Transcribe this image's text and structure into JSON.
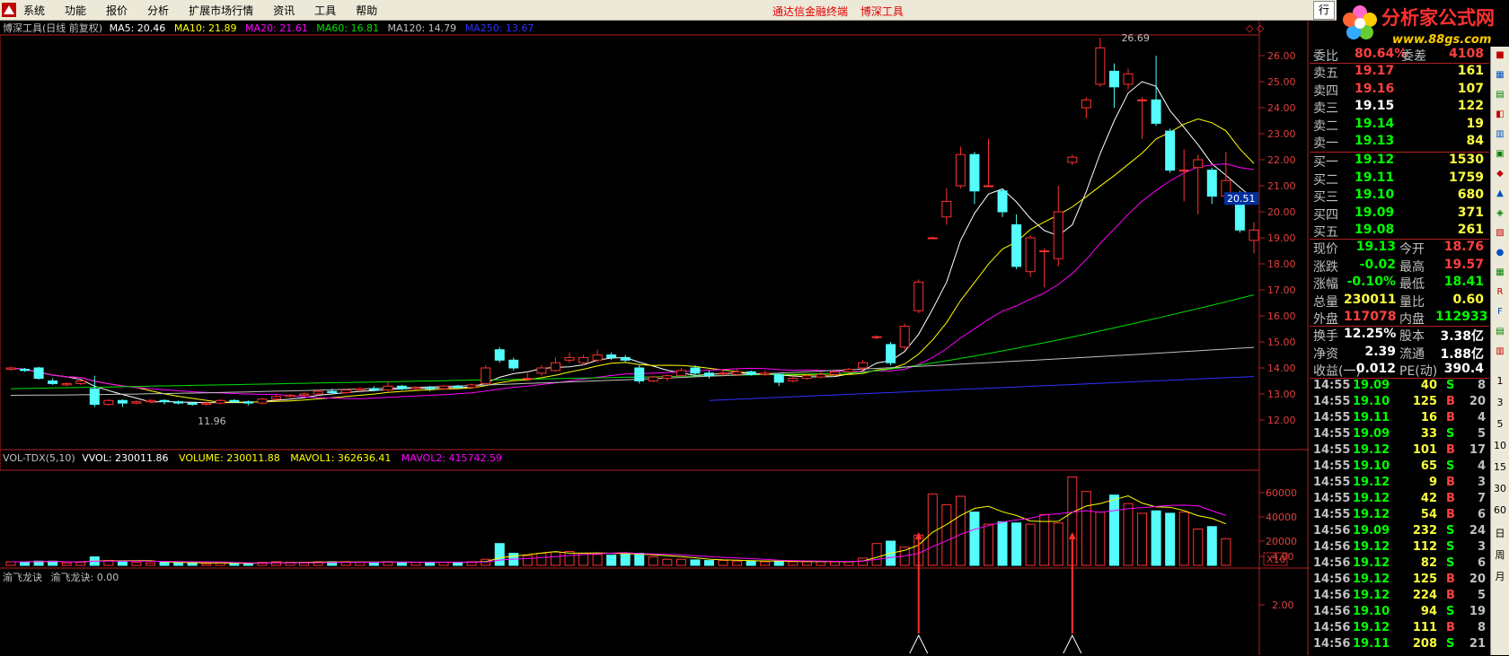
{
  "menu": {
    "items": [
      "系统",
      "功能",
      "报价",
      "分析",
      "扩展市场行情",
      "资讯",
      "工具",
      "帮助"
    ],
    "center": [
      "通达信金融终端",
      "博深工具"
    ],
    "right_box": "行"
  },
  "brand": {
    "title": "分析家公式网",
    "url": "www.88gs.com"
  },
  "main_chart": {
    "header": {
      "name": "博深工具(日线 前复权)",
      "ma5": "MA5: 20.46",
      "ma10": "MA10: 21.89",
      "ma20": "MA20: 21.61",
      "ma60": "MA60: 16.81",
      "ma120": "MA120: 14.79",
      "ma250": "MA250: 13.67"
    },
    "high_label": "26.69",
    "low_label": "11.96",
    "cursor_price": "20.51",
    "y_ticks": [
      "26.00",
      "25.00",
      "24.00",
      "23.00",
      "22.00",
      "21.00",
      "20.00",
      "19.00",
      "18.00",
      "17.00",
      "16.00",
      "15.00",
      "14.00",
      "13.00",
      "12.00"
    ],
    "colors": {
      "up": "#ff3232",
      "down": "#54fcfc",
      "ma5": "#ffffff",
      "ma10": "#ffff00",
      "ma20": "#ff00ff",
      "ma60": "#00e000",
      "ma120": "#c0c0c0",
      "ma250": "#3030ff"
    }
  },
  "volume_chart": {
    "header": {
      "name": "VOL-TDX(5,10)",
      "vvol": "VVOL: 230011.86",
      "volume": "VOLUME: 230011.88",
      "mavol1": "MAVOL1: 362636.41",
      "mavol2": "MAVOL2: 415742.59"
    },
    "y_ticks": [
      "60000",
      "40000",
      "20000"
    ],
    "unit": "X10"
  },
  "indicator_chart": {
    "header": {
      "name": "渝飞龙诀",
      "value": "渝飞龙诀: 0.00"
    },
    "y_ticks": [
      "4.00",
      "2.00"
    ]
  },
  "quote": {
    "ratio": {
      "label": "委比",
      "value": "80.64%",
      "label2": "委差",
      "value2": "4108"
    },
    "sells": [
      {
        "label": "卖五",
        "price": "19.17",
        "vol": "161"
      },
      {
        "label": "卖四",
        "price": "19.16",
        "vol": "107"
      },
      {
        "label": "卖三",
        "price": "19.15",
        "vol": "122"
      },
      {
        "label": "卖二",
        "price": "19.14",
        "vol": "19"
      },
      {
        "label": "卖一",
        "price": "19.13",
        "vol": "84"
      }
    ],
    "buys": [
      {
        "label": "买一",
        "price": "19.12",
        "vol": "1530"
      },
      {
        "label": "买二",
        "price": "19.11",
        "vol": "1759"
      },
      {
        "label": "买三",
        "price": "19.10",
        "vol": "680"
      },
      {
        "label": "买四",
        "price": "19.09",
        "vol": "371"
      },
      {
        "label": "买五",
        "price": "19.08",
        "vol": "261"
      }
    ],
    "stats": [
      {
        "l1": "现价",
        "v1": "19.13",
        "l2": "今开",
        "v2": "18.76"
      },
      {
        "l1": "涨跌",
        "v1": "-0.02",
        "l2": "最高",
        "v2": "19.57"
      },
      {
        "l1": "涨幅",
        "v1": "-0.10%",
        "l2": "最低",
        "v2": "18.41"
      },
      {
        "l1": "总量",
        "v1": "230011",
        "l2": "量比",
        "v2": "0.60"
      },
      {
        "l1": "外盘",
        "v1": "117078",
        "l2": "内盘",
        "v2": "112933"
      }
    ],
    "fundamentals": [
      {
        "l1": "换手",
        "v1": "12.25%",
        "l2": "股本",
        "v2": "3.38亿"
      },
      {
        "l1": "净资",
        "v1": "2.39",
        "l2": "流通",
        "v2": "1.88亿"
      },
      {
        "l1": "收益(一)",
        "v1": "0.012",
        "l2": "PE(动)",
        "v2": "390.4"
      }
    ],
    "ticks": [
      {
        "time": "14:55",
        "price": "19.09",
        "vol": "40",
        "bs": "S",
        "n": "8"
      },
      {
        "time": "14:55",
        "price": "19.10",
        "vol": "125",
        "bs": "B",
        "n": "20"
      },
      {
        "time": "14:55",
        "price": "19.11",
        "vol": "16",
        "bs": "B",
        "n": "4"
      },
      {
        "time": "14:55",
        "price": "19.09",
        "vol": "33",
        "bs": "S",
        "n": "5"
      },
      {
        "time": "14:55",
        "price": "19.12",
        "vol": "101",
        "bs": "B",
        "n": "17"
      },
      {
        "time": "14:55",
        "price": "19.10",
        "vol": "65",
        "bs": "S",
        "n": "4"
      },
      {
        "time": "14:55",
        "price": "19.12",
        "vol": "9",
        "bs": "B",
        "n": "3"
      },
      {
        "time": "14:55",
        "price": "19.12",
        "vol": "42",
        "bs": "B",
        "n": "7"
      },
      {
        "time": "14:55",
        "price": "19.12",
        "vol": "54",
        "bs": "B",
        "n": "6"
      },
      {
        "time": "14:56",
        "price": "19.09",
        "vol": "232",
        "bs": "S",
        "n": "24"
      },
      {
        "time": "14:56",
        "price": "19.12",
        "vol": "112",
        "bs": "S",
        "n": "3"
      },
      {
        "time": "14:56",
        "price": "19.12",
        "vol": "82",
        "bs": "S",
        "n": "6"
      },
      {
        "time": "14:56",
        "price": "19.12",
        "vol": "125",
        "bs": "B",
        "n": "20"
      },
      {
        "time": "14:56",
        "price": "19.12",
        "vol": "224",
        "bs": "B",
        "n": "5"
      },
      {
        "time": "14:56",
        "price": "19.10",
        "vol": "94",
        "bs": "S",
        "n": "19"
      },
      {
        "time": "14:56",
        "price": "19.12",
        "vol": "111",
        "bs": "B",
        "n": "8"
      },
      {
        "time": "14:56",
        "price": "19.11",
        "vol": "208",
        "bs": "S",
        "n": "21"
      }
    ],
    "colors": {
      "up": "#ff4040",
      "down": "#00ff00",
      "label": "#c0c0c0",
      "neutral": "#ffffff",
      "yellow": "#ffff40"
    }
  },
  "toolbar": [
    "1",
    "3",
    "5",
    "10",
    "15",
    "30",
    "60",
    "日",
    "周",
    "月"
  ],
  "chart_data": [
    {
      "type": "candlestick",
      "title": "博深工具(日线 前复权)",
      "candles": [
        [
          13.95,
          14.0,
          13.9,
          14.05
        ],
        [
          13.95,
          13.9,
          13.85,
          14.0
        ],
        [
          14.0,
          13.6,
          13.55,
          14.05
        ],
        [
          13.5,
          13.4,
          13.35,
          13.6
        ],
        [
          13.35,
          13.4,
          13.3,
          13.45
        ],
        [
          13.4,
          13.5,
          13.35,
          13.55
        ],
        [
          13.2,
          12.6,
          12.5,
          13.7
        ],
        [
          12.6,
          12.75,
          12.55,
          12.8
        ],
        [
          12.75,
          12.65,
          12.5,
          12.8
        ],
        [
          12.65,
          12.7,
          12.6,
          12.75
        ],
        [
          12.7,
          12.75,
          12.65,
          12.8
        ],
        [
          12.75,
          12.7,
          12.6,
          12.8
        ],
        [
          12.7,
          12.65,
          12.6,
          12.75
        ],
        [
          12.65,
          12.6,
          12.55,
          12.7
        ],
        [
          12.6,
          12.65,
          12.55,
          12.7
        ],
        [
          12.65,
          12.75,
          12.6,
          12.8
        ],
        [
          12.75,
          12.7,
          12.65,
          12.8
        ],
        [
          12.7,
          12.65,
          12.55,
          12.75
        ],
        [
          12.65,
          12.8,
          12.6,
          12.85
        ],
        [
          12.8,
          12.9,
          12.75,
          12.95
        ],
        [
          12.9,
          12.95,
          12.85,
          13.0
        ],
        [
          12.95,
          13.0,
          12.9,
          13.05
        ],
        [
          13.0,
          13.1,
          12.95,
          13.15
        ],
        [
          13.1,
          13.05,
          13.0,
          13.2
        ],
        [
          13.05,
          13.15,
          13.0,
          13.2
        ],
        [
          13.15,
          13.2,
          13.1,
          13.25
        ],
        [
          13.2,
          13.15,
          13.1,
          13.3
        ],
        [
          13.15,
          13.3,
          13.1,
          13.5
        ],
        [
          13.3,
          13.2,
          13.15,
          13.35
        ],
        [
          13.2,
          13.25,
          13.15,
          13.3
        ],
        [
          13.25,
          13.2,
          13.1,
          13.3
        ],
        [
          13.2,
          13.3,
          13.15,
          13.35
        ],
        [
          13.3,
          13.25,
          13.2,
          13.35
        ],
        [
          13.25,
          13.35,
          13.2,
          13.4
        ],
        [
          13.4,
          14.0,
          13.3,
          14.1
        ],
        [
          14.7,
          14.3,
          14.2,
          14.8
        ],
        [
          14.3,
          14.0,
          13.9,
          14.4
        ],
        [
          13.6,
          13.6,
          13.5,
          13.8
        ],
        [
          13.8,
          14.0,
          13.7,
          14.1
        ],
        [
          13.9,
          14.2,
          13.85,
          14.4
        ],
        [
          14.3,
          14.4,
          14.2,
          14.6
        ],
        [
          14.2,
          14.4,
          14.1,
          14.5
        ],
        [
          14.3,
          14.5,
          14.2,
          14.7
        ],
        [
          14.5,
          14.4,
          14.3,
          14.6
        ],
        [
          14.4,
          14.3,
          14.2,
          14.5
        ],
        [
          14.0,
          13.5,
          13.4,
          14.1
        ],
        [
          13.5,
          13.65,
          13.45,
          13.7
        ],
        [
          13.6,
          13.7,
          13.5,
          13.75
        ],
        [
          13.7,
          13.9,
          13.6,
          14.0
        ],
        [
          14.0,
          13.8,
          13.7,
          14.1
        ],
        [
          13.8,
          13.7,
          13.6,
          13.9
        ],
        [
          13.8,
          13.8,
          13.7,
          13.9
        ],
        [
          13.75,
          13.85,
          13.7,
          13.95
        ],
        [
          13.85,
          13.75,
          13.7,
          13.9
        ],
        [
          13.75,
          13.8,
          13.7,
          13.9
        ],
        [
          13.75,
          13.45,
          13.3,
          13.8
        ],
        [
          13.5,
          13.6,
          13.45,
          13.7
        ],
        [
          13.6,
          13.7,
          13.55,
          13.8
        ],
        [
          13.65,
          13.75,
          13.6,
          13.85
        ],
        [
          13.75,
          13.85,
          13.7,
          13.9
        ],
        [
          13.85,
          13.95,
          13.8,
          14.0
        ],
        [
          14.0,
          14.2,
          13.9,
          14.3
        ],
        [
          15.2,
          15.2,
          15.1,
          15.25
        ],
        [
          14.9,
          14.2,
          14.1,
          15.0
        ],
        [
          14.8,
          15.6,
          14.7,
          15.7
        ],
        [
          16.2,
          17.3,
          16.1,
          17.4
        ],
        [
          19.0,
          19.0,
          18.95,
          19.05
        ],
        [
          19.8,
          20.4,
          19.5,
          20.9
        ],
        [
          21.0,
          22.2,
          20.9,
          22.5
        ],
        [
          22.2,
          20.8,
          20.3,
          22.3
        ],
        [
          21.0,
          21.0,
          21.0,
          22.8
        ],
        [
          20.8,
          20.0,
          19.8,
          20.9
        ],
        [
          19.5,
          17.9,
          17.8,
          19.9
        ],
        [
          17.7,
          19.0,
          17.5,
          19.1
        ],
        [
          18.5,
          18.5,
          17.1,
          18.6
        ],
        [
          18.2,
          20.0,
          17.9,
          21.0
        ],
        [
          21.9,
          22.1,
          21.8,
          22.2
        ],
        [
          24.0,
          24.3,
          23.6,
          24.4
        ],
        [
          24.9,
          26.3,
          24.8,
          26.69
        ],
        [
          25.4,
          24.8,
          24.0,
          25.7
        ],
        [
          24.9,
          25.3,
          24.7,
          25.5
        ],
        [
          24.3,
          24.3,
          22.8,
          24.4
        ],
        [
          24.3,
          23.4,
          23.3,
          26.0
        ],
        [
          23.1,
          21.6,
          21.5,
          23.2
        ],
        [
          21.6,
          21.6,
          20.4,
          22.4
        ],
        [
          21.7,
          22.0,
          19.9,
          22.2
        ],
        [
          21.6,
          20.6,
          20.3,
          21.7
        ],
        [
          20.6,
          21.2,
          20.5,
          22.3
        ],
        [
          20.6,
          19.3,
          19.2,
          20.8
        ],
        [
          18.9,
          19.3,
          18.4,
          19.6
        ]
      ],
      "ma_lines": [
        "MA5",
        "MA10",
        "MA20",
        "MA60",
        "MA120",
        "MA250"
      ]
    },
    {
      "type": "bar",
      "title": "VOL-TDX(5,10)",
      "values": [
        3000,
        3000,
        3500,
        3500,
        2000,
        2500,
        7000,
        4000,
        3500,
        2500,
        2000,
        2500,
        2000,
        2000,
        1500,
        2000,
        2000,
        1500,
        2500,
        3000,
        2500,
        2500,
        3000,
        3000,
        3000,
        2500,
        2500,
        3000,
        2500,
        2500,
        2500,
        2500,
        2500,
        3000,
        5000,
        18000,
        10000,
        8000,
        10000,
        11000,
        11500,
        10000,
        9000,
        8500,
        9000,
        10000,
        7000,
        5000,
        5000,
        4500,
        4000,
        4000,
        3500,
        3500,
        3000,
        3500,
        3000,
        3000,
        3000,
        3000,
        3000,
        6000,
        18000,
        20000,
        15000,
        25000,
        59000,
        50000,
        57000,
        44000,
        34000,
        36000,
        35000,
        34000,
        42000,
        35000,
        73000,
        61000,
        44000,
        58000,
        51000,
        43000,
        45000,
        43000,
        44000,
        30000,
        32000,
        22000
      ]
    },
    {
      "type": "bar",
      "title": "渝飞龙诀",
      "values": [
        0,
        0,
        0,
        0,
        0,
        0,
        0,
        0,
        0,
        0,
        0,
        0,
        0,
        0,
        0,
        0,
        0,
        0,
        0,
        0,
        0,
        0,
        0,
        0,
        0,
        0,
        0,
        0,
        0,
        0,
        0,
        0,
        0,
        0,
        0,
        0,
        0,
        0,
        0,
        0,
        0,
        0,
        0,
        0,
        0,
        0,
        0,
        0,
        0,
        0,
        0,
        0,
        0,
        0,
        0,
        0,
        0,
        0,
        0,
        0,
        0,
        0,
        0,
        0,
        0,
        5,
        0,
        0,
        0,
        0,
        0,
        0,
        0,
        0,
        0,
        0,
        5,
        0,
        0,
        0,
        0,
        0,
        0,
        0,
        0,
        0,
        0,
        0,
        0,
        0
      ],
      "ylim": [
        0,
        5
      ]
    }
  ]
}
